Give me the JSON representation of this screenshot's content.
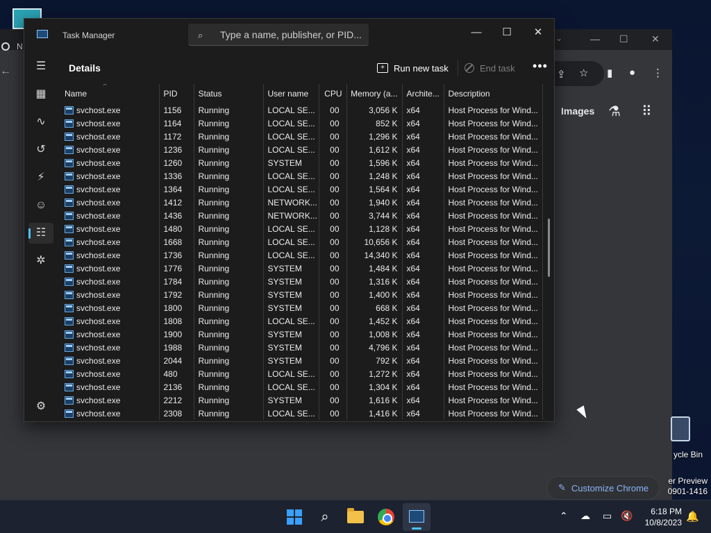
{
  "desktop": {
    "recycle_bin_label": "ycle Bin",
    "watermark_line1": "er Preview",
    "watermark_line2": "0901-1416"
  },
  "chrome": {
    "tab_text": "N",
    "images_link": "Images",
    "customize_label": "Customize Chrome",
    "accent_color": "#8ab4f8"
  },
  "task_manager": {
    "app_title": "Task Manager",
    "search": {
      "placeholder": "Type a name, publisher, or PID..."
    },
    "page_title": "Details",
    "toolbar": {
      "run_new_task": "Run new task",
      "end_task": "End task",
      "more": "..."
    },
    "window_controls": {
      "minimize": "—",
      "maximize": "☐",
      "close": "✕"
    },
    "sidebar": [
      {
        "name": "hamburger-menu-icon",
        "glyph": "☰"
      },
      {
        "name": "processes-icon",
        "glyph": "▦"
      },
      {
        "name": "performance-icon",
        "glyph": "∿"
      },
      {
        "name": "app-history-icon",
        "glyph": "↺"
      },
      {
        "name": "startup-apps-icon",
        "glyph": "⚡"
      },
      {
        "name": "users-icon",
        "glyph": "👥"
      },
      {
        "name": "details-icon",
        "glyph": "☷"
      },
      {
        "name": "services-icon",
        "glyph": "⚙"
      },
      {
        "name": "settings-icon",
        "glyph": "⚙"
      }
    ],
    "columns": [
      "Name",
      "PID",
      "Status",
      "User name",
      "CPU",
      "Memory (a...",
      "Archite...",
      "Description"
    ],
    "rows": [
      [
        "svchost.exe",
        "1156",
        "Running",
        "LOCAL SE...",
        "00",
        "3,056 K",
        "x64",
        "Host Process for Wind..."
      ],
      [
        "svchost.exe",
        "1164",
        "Running",
        "LOCAL SE...",
        "00",
        "852 K",
        "x64",
        "Host Process for Wind..."
      ],
      [
        "svchost.exe",
        "1172",
        "Running",
        "LOCAL SE...",
        "00",
        "1,296 K",
        "x64",
        "Host Process for Wind..."
      ],
      [
        "svchost.exe",
        "1236",
        "Running",
        "LOCAL SE...",
        "00",
        "1,612 K",
        "x64",
        "Host Process for Wind..."
      ],
      [
        "svchost.exe",
        "1260",
        "Running",
        "SYSTEM",
        "00",
        "1,596 K",
        "x64",
        "Host Process for Wind..."
      ],
      [
        "svchost.exe",
        "1336",
        "Running",
        "LOCAL SE...",
        "00",
        "1,248 K",
        "x64",
        "Host Process for Wind..."
      ],
      [
        "svchost.exe",
        "1364",
        "Running",
        "LOCAL SE...",
        "00",
        "1,564 K",
        "x64",
        "Host Process for Wind..."
      ],
      [
        "svchost.exe",
        "1412",
        "Running",
        "NETWORK...",
        "00",
        "1,940 K",
        "x64",
        "Host Process for Wind..."
      ],
      [
        "svchost.exe",
        "1436",
        "Running",
        "NETWORK...",
        "00",
        "3,744 K",
        "x64",
        "Host Process for Wind..."
      ],
      [
        "svchost.exe",
        "1480",
        "Running",
        "LOCAL SE...",
        "00",
        "1,128 K",
        "x64",
        "Host Process for Wind..."
      ],
      [
        "svchost.exe",
        "1668",
        "Running",
        "LOCAL SE...",
        "00",
        "10,656 K",
        "x64",
        "Host Process for Wind..."
      ],
      [
        "svchost.exe",
        "1736",
        "Running",
        "LOCAL SE...",
        "00",
        "14,340 K",
        "x64",
        "Host Process for Wind..."
      ],
      [
        "svchost.exe",
        "1776",
        "Running",
        "SYSTEM",
        "00",
        "1,484 K",
        "x64",
        "Host Process for Wind..."
      ],
      [
        "svchost.exe",
        "1784",
        "Running",
        "SYSTEM",
        "00",
        "1,316 K",
        "x64",
        "Host Process for Wind..."
      ],
      [
        "svchost.exe",
        "1792",
        "Running",
        "SYSTEM",
        "00",
        "1,400 K",
        "x64",
        "Host Process for Wind..."
      ],
      [
        "svchost.exe",
        "1800",
        "Running",
        "SYSTEM",
        "00",
        "668 K",
        "x64",
        "Host Process for Wind..."
      ],
      [
        "svchost.exe",
        "1808",
        "Running",
        "LOCAL SE...",
        "00",
        "1,452 K",
        "x64",
        "Host Process for Wind..."
      ],
      [
        "svchost.exe",
        "1900",
        "Running",
        "SYSTEM",
        "00",
        "1,008 K",
        "x64",
        "Host Process for Wind..."
      ],
      [
        "svchost.exe",
        "1988",
        "Running",
        "SYSTEM",
        "00",
        "4,796 K",
        "x64",
        "Host Process for Wind..."
      ],
      [
        "svchost.exe",
        "2044",
        "Running",
        "SYSTEM",
        "00",
        "792 K",
        "x64",
        "Host Process for Wind..."
      ],
      [
        "svchost.exe",
        "480",
        "Running",
        "LOCAL SE...",
        "00",
        "1,272 K",
        "x64",
        "Host Process for Wind..."
      ],
      [
        "svchost.exe",
        "2136",
        "Running",
        "LOCAL SE...",
        "00",
        "1,304 K",
        "x64",
        "Host Process for Wind..."
      ],
      [
        "svchost.exe",
        "2212",
        "Running",
        "SYSTEM",
        "00",
        "1,616 K",
        "x64",
        "Host Process for Wind..."
      ],
      [
        "svchost.exe",
        "2308",
        "Running",
        "LOCAL SE...",
        "00",
        "1,416 K",
        "x64",
        "Host Process for Wind..."
      ]
    ],
    "accent_color": "#4cc2ff"
  },
  "taskbar": {
    "time": "6:18 PM",
    "date": "10/8/2023",
    "pinned": [
      "start-button",
      "search-button",
      "file-explorer-button",
      "chrome-button",
      "task-manager-button"
    ]
  }
}
